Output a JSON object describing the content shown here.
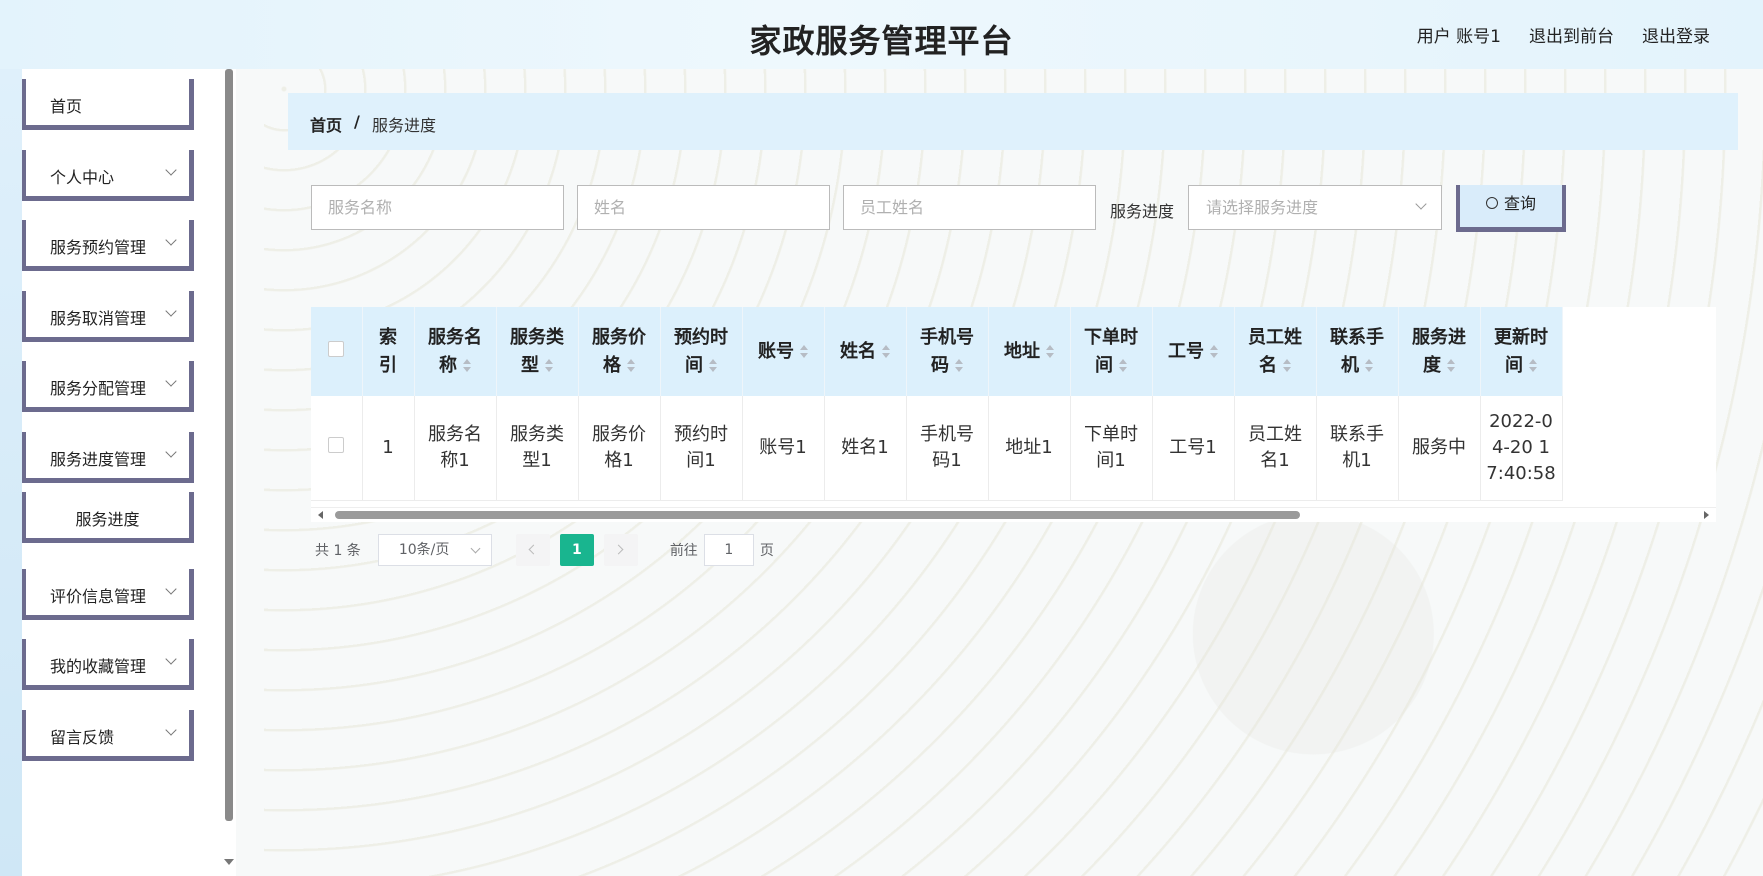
{
  "header": {
    "title": "家政服务管理平台",
    "user_label": "用户 账号1",
    "back_front": "退出到前台",
    "logout": "退出登录"
  },
  "sidebar": {
    "items": [
      {
        "label": "首页",
        "has_chevron": false
      },
      {
        "label": "个人中心",
        "has_chevron": true
      },
      {
        "label": "服务预约管理",
        "has_chevron": true
      },
      {
        "label": "服务取消管理",
        "has_chevron": true
      },
      {
        "label": "服务分配管理",
        "has_chevron": true
      },
      {
        "label": "服务进度管理",
        "has_chevron": true
      },
      {
        "label": "服务进度",
        "submenu": true
      },
      {
        "label": "评价信息管理",
        "has_chevron": true
      },
      {
        "label": "我的收藏管理",
        "has_chevron": true
      },
      {
        "label": "留言反馈",
        "has_chevron": true
      }
    ]
  },
  "breadcrumb": {
    "home": "首页",
    "separator": "/",
    "current": "服务进度"
  },
  "search": {
    "service_name_placeholder": "服务名称",
    "name_placeholder": "姓名",
    "employee_name_placeholder": "员工姓名",
    "progress_label": "服务进度",
    "progress_placeholder": "请选择服务进度",
    "query_button": "查询"
  },
  "table": {
    "headers": [
      {
        "lines": [
          "索",
          "引"
        ],
        "sortable": false
      },
      {
        "lines": [
          "服务名",
          "称"
        ],
        "sortable": true
      },
      {
        "lines": [
          "服务类",
          "型"
        ],
        "sortable": true
      },
      {
        "lines": [
          "服务价",
          "格"
        ],
        "sortable": true
      },
      {
        "lines": [
          "预约时",
          "间"
        ],
        "sortable": true
      },
      {
        "lines": [
          "账号"
        ],
        "sortable": true
      },
      {
        "lines": [
          "姓名"
        ],
        "sortable": true
      },
      {
        "lines": [
          "手机号",
          "码"
        ],
        "sortable": true
      },
      {
        "lines": [
          "地址"
        ],
        "sortable": true
      },
      {
        "lines": [
          "下单时",
          "间"
        ],
        "sortable": true
      },
      {
        "lines": [
          "工号"
        ],
        "sortable": true
      },
      {
        "lines": [
          "员工姓",
          "名"
        ],
        "sortable": true
      },
      {
        "lines": [
          "联系手",
          "机"
        ],
        "sortable": true
      },
      {
        "lines": [
          "服务进",
          "度"
        ],
        "sortable": true
      },
      {
        "lines": [
          "更新时",
          "间"
        ],
        "sortable": true
      }
    ],
    "rows": [
      [
        [
          "1"
        ],
        [
          "服务名",
          "称1"
        ],
        [
          "服务类",
          "型1"
        ],
        [
          "服务价",
          "格1"
        ],
        [
          "预约时",
          "间1"
        ],
        [
          "账号1"
        ],
        [
          "姓名1"
        ],
        [
          "手机号",
          "码1"
        ],
        [
          "地址1"
        ],
        [
          "下单时",
          "间1"
        ],
        [
          "工号1"
        ],
        [
          "员工姓",
          "名1"
        ],
        [
          "联系手",
          "机1"
        ],
        [
          "服务中"
        ],
        [
          "2022-0",
          "4-20 1",
          "7:40:58"
        ]
      ]
    ]
  },
  "pagination": {
    "total": "共 1 条",
    "page_size": "10条/页",
    "current_page": "1",
    "goto_label": "前往",
    "goto_value": "1",
    "page_suffix": "页"
  },
  "colors": {
    "accent": "#19b58f",
    "menu_border": "#6c6b8e",
    "header_bg": "#e3f3fc",
    "table_header_bg": "#dcf0fc"
  }
}
